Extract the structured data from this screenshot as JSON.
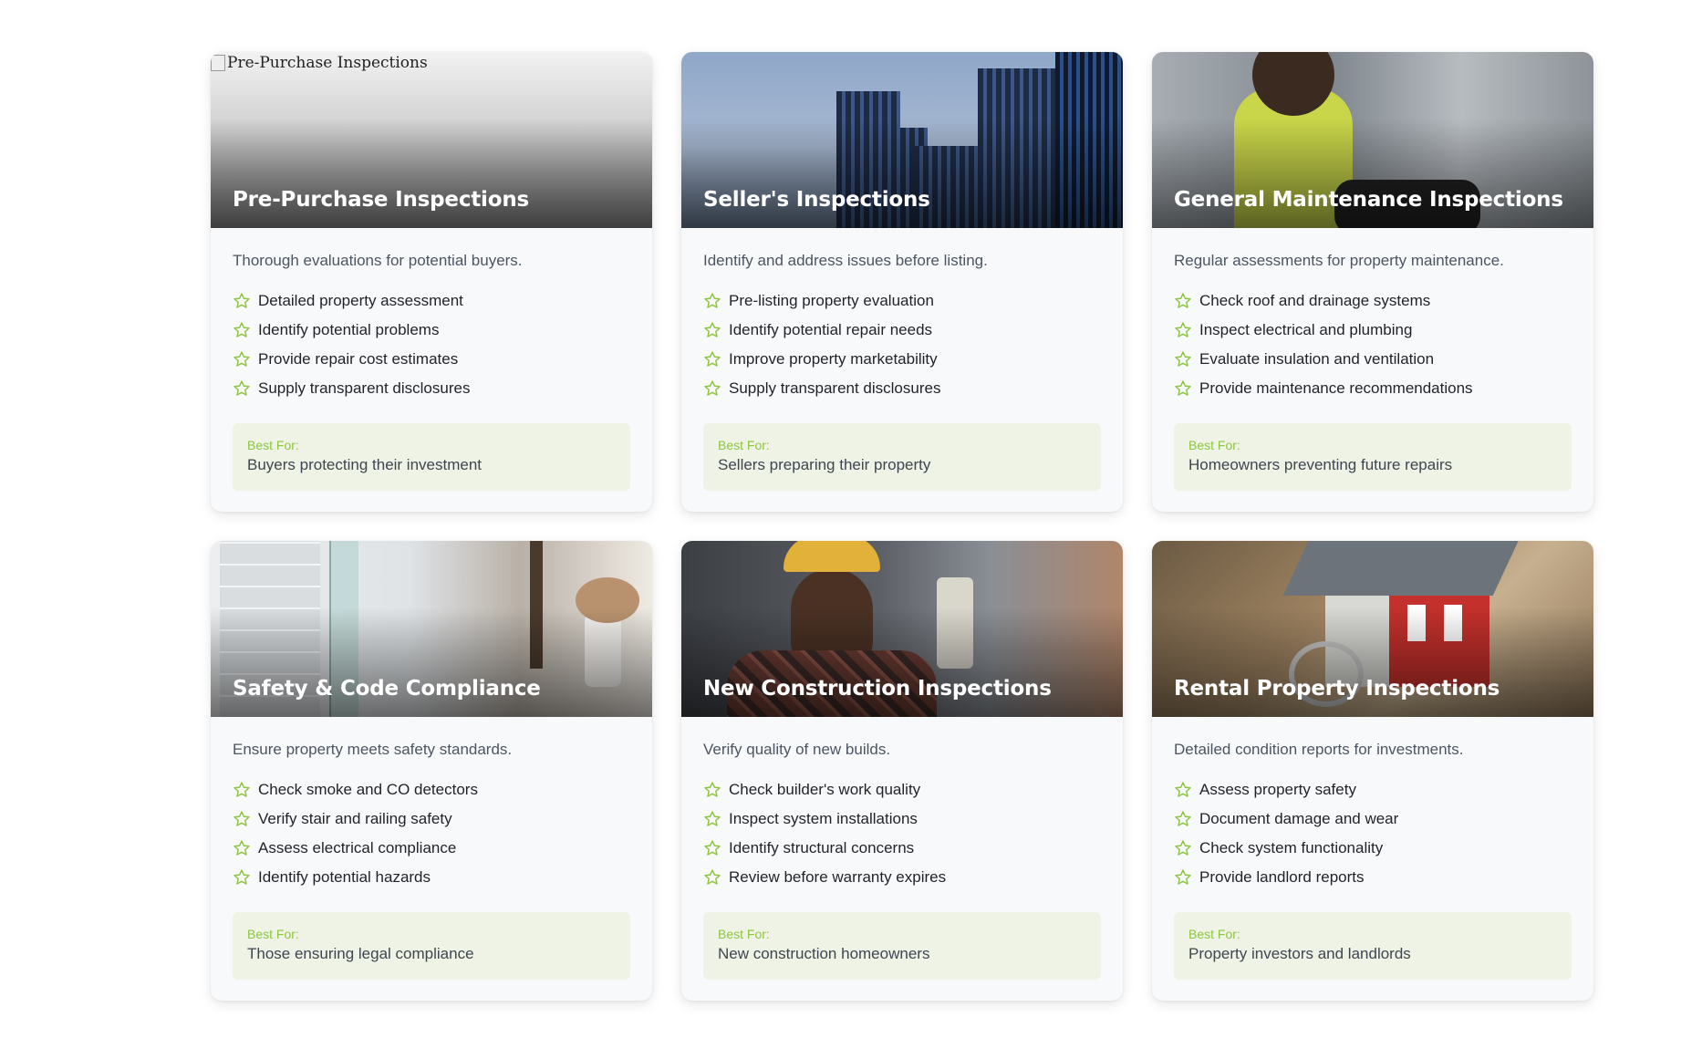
{
  "icons": {
    "feature": "star-outline-icon",
    "accent": "#8cc63f"
  },
  "cards": [
    {
      "title": "Pre-Purchase Inspections",
      "image_alt": "Pre-Purchase Inspections",
      "description": "Thorough evaluations for potential buyers.",
      "features": [
        "Detailed property assessment",
        "Identify potential problems",
        "Provide repair cost estimates",
        "Supply transparent disclosures"
      ],
      "best_for_label": "Best For:",
      "best_for": "Buyers protecting their investment"
    },
    {
      "title": "Seller's Inspections",
      "description": "Identify and address issues before listing.",
      "features": [
        "Pre-listing property evaluation",
        "Identify potential repair needs",
        "Improve property marketability",
        "Supply transparent disclosures"
      ],
      "best_for_label": "Best For:",
      "best_for": "Sellers preparing their property"
    },
    {
      "title": "General Maintenance Inspections",
      "description": "Regular assessments for property maintenance.",
      "features": [
        "Check roof and drainage systems",
        "Inspect electrical and plumbing",
        "Evaluate insulation and ventilation",
        "Provide maintenance recommendations"
      ],
      "best_for_label": "Best For:",
      "best_for": "Homeowners preventing future repairs"
    },
    {
      "title": "Safety & Code Compliance",
      "description": "Ensure property meets safety standards.",
      "features": [
        "Check smoke and CO detectors",
        "Verify stair and railing safety",
        "Assess electrical compliance",
        "Identify potential hazards"
      ],
      "best_for_label": "Best For:",
      "best_for": "Those ensuring legal compliance"
    },
    {
      "title": "New Construction Inspections",
      "description": "Verify quality of new builds.",
      "features": [
        "Check builder's work quality",
        "Inspect system installations",
        "Identify structural concerns",
        "Review before warranty expires"
      ],
      "best_for_label": "Best For:",
      "best_for": "New construction homeowners"
    },
    {
      "title": "Rental Property Inspections",
      "description": "Detailed condition reports for investments.",
      "features": [
        "Assess property safety",
        "Document damage and wear",
        "Check system functionality",
        "Provide landlord reports"
      ],
      "best_for_label": "Best For:",
      "best_for": "Property investors and landlords"
    }
  ]
}
